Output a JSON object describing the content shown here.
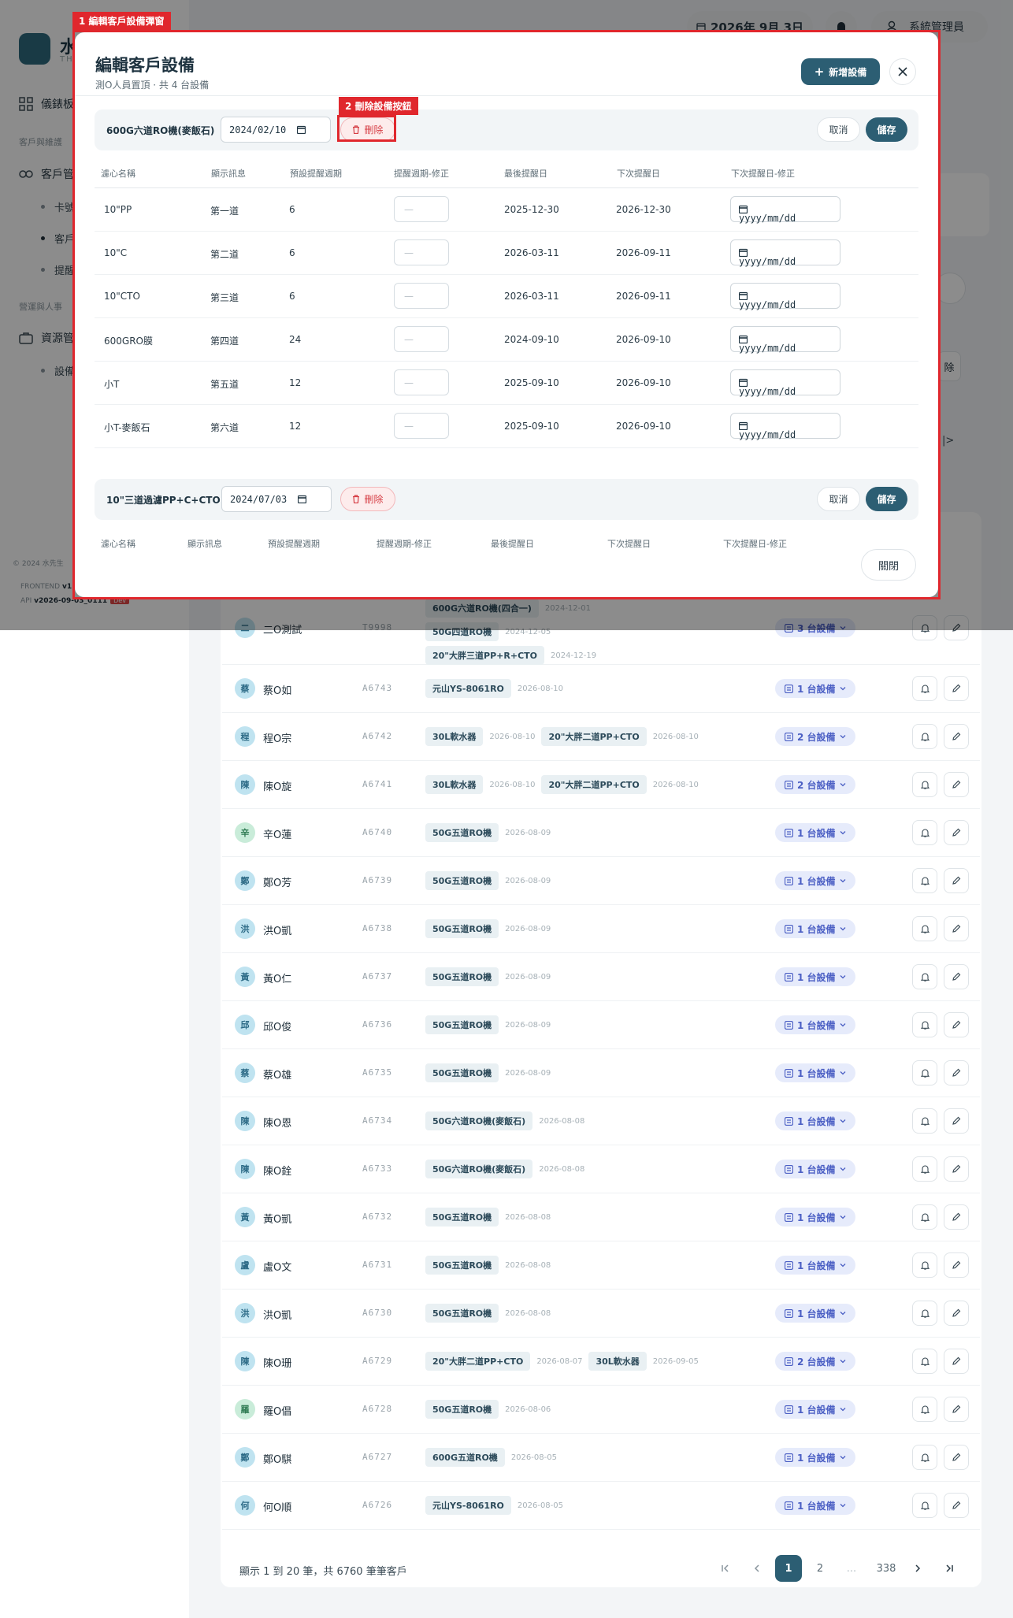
{
  "app": {
    "logo_text": "水",
    "logo_sub": "THE",
    "topbar_date": "2026年 9月 3日",
    "user_name": "系統管理員"
  },
  "sidebar": {
    "dashboard": "儀錶板",
    "section_customers": "客戶與維護",
    "customers": "客戶管",
    "sub1": "卡號",
    "sub2": "客戶",
    "sub3": "提醒",
    "section_admin": "營運與人事",
    "resources": "資源管",
    "sub4": "設備",
    "footer_copy": "© 2024 水先生",
    "footer_frontend_label": "FRONTEND",
    "footer_frontend_val": "v1",
    "footer_api_label": "API",
    "footer_api_val": "v2026-09-03_0111",
    "footer_badge": "Dev"
  },
  "background_partial": {
    "label_1": "除",
    "label_2": "|>"
  },
  "customers": [
    {
      "avatar": "二",
      "color": "#bfe3f0",
      "text_color": "#2c6a86",
      "name": "二O測試",
      "code": "T9998",
      "devices": [
        {
          "name": "600G六道RO機(四合一)",
          "date": "2024-12-01"
        },
        {
          "name": "50G四道RO機",
          "date": "2024-12-05"
        },
        {
          "name": "20\"大胖三道PP+R+CTO",
          "date": "2024-12-19"
        }
      ],
      "count": "3 台設備"
    },
    {
      "avatar": "蔡",
      "color": "#bfe3f0",
      "text_color": "#2c6a86",
      "name": "蔡O如",
      "code": "A6743",
      "devices": [
        {
          "name": "元山YS-8061RO",
          "date": "2026-08-10"
        }
      ],
      "count": "1 台設備"
    },
    {
      "avatar": "程",
      "color": "#bfe3f0",
      "text_color": "#2c6a86",
      "name": "程O宗",
      "code": "A6742",
      "devices": [
        {
          "name": "30L軟水器",
          "date": "2026-08-10"
        },
        {
          "name": "20\"大胖二道PP+CTO",
          "date": "2026-08-10"
        }
      ],
      "count": "2 台設備"
    },
    {
      "avatar": "陳",
      "color": "#bfe3f0",
      "text_color": "#2c6a86",
      "name": "陳O旋",
      "code": "A6741",
      "devices": [
        {
          "name": "30L軟水器",
          "date": "2026-08-10"
        },
        {
          "name": "20\"大胖二道PP+CTO",
          "date": "2026-08-10"
        }
      ],
      "count": "2 台設備"
    },
    {
      "avatar": "辛",
      "color": "#c9ecd9",
      "text_color": "#2e7a52",
      "name": "辛O蓮",
      "code": "A6740",
      "devices": [
        {
          "name": "50G五道RO機",
          "date": "2026-08-09"
        }
      ],
      "count": "1 台設備"
    },
    {
      "avatar": "鄭",
      "color": "#bfe3f0",
      "text_color": "#2c6a86",
      "name": "鄭O芳",
      "code": "A6739",
      "devices": [
        {
          "name": "50G五道RO機",
          "date": "2026-08-09"
        }
      ],
      "count": "1 台設備"
    },
    {
      "avatar": "洪",
      "color": "#bfe3f0",
      "text_color": "#2c6a86",
      "name": "洪O凱",
      "code": "A6738",
      "devices": [
        {
          "name": "50G五道RO機",
          "date": "2026-08-09"
        }
      ],
      "count": "1 台設備"
    },
    {
      "avatar": "黃",
      "color": "#bfe3f0",
      "text_color": "#2c6a86",
      "name": "黃O仁",
      "code": "A6737",
      "devices": [
        {
          "name": "50G五道RO機",
          "date": "2026-08-09"
        }
      ],
      "count": "1 台設備"
    },
    {
      "avatar": "邱",
      "color": "#bfe3f0",
      "text_color": "#2c6a86",
      "name": "邱O俊",
      "code": "A6736",
      "devices": [
        {
          "name": "50G五道RO機",
          "date": "2026-08-09"
        }
      ],
      "count": "1 台設備"
    },
    {
      "avatar": "蔡",
      "color": "#bfe3f0",
      "text_color": "#2c6a86",
      "name": "蔡O雄",
      "code": "A6735",
      "devices": [
        {
          "name": "50G五道RO機",
          "date": "2026-08-09"
        }
      ],
      "count": "1 台設備"
    },
    {
      "avatar": "陳",
      "color": "#bfe3f0",
      "text_color": "#2c6a86",
      "name": "陳O恩",
      "code": "A6734",
      "devices": [
        {
          "name": "50G六道RO機(麥飯石)",
          "date": "2026-08-08"
        }
      ],
      "count": "1 台設備"
    },
    {
      "avatar": "陳",
      "color": "#bfe3f0",
      "text_color": "#2c6a86",
      "name": "陳O銓",
      "code": "A6733",
      "devices": [
        {
          "name": "50G六道RO機(麥飯石)",
          "date": "2026-08-08"
        }
      ],
      "count": "1 台設備"
    },
    {
      "avatar": "黃",
      "color": "#bfe3f0",
      "text_color": "#2c6a86",
      "name": "黃O凱",
      "code": "A6732",
      "devices": [
        {
          "name": "50G五道RO機",
          "date": "2026-08-08"
        }
      ],
      "count": "1 台設備"
    },
    {
      "avatar": "盧",
      "color": "#bfe3f0",
      "text_color": "#2c6a86",
      "name": "盧O文",
      "code": "A6731",
      "devices": [
        {
          "name": "50G五道RO機",
          "date": "2026-08-08"
        }
      ],
      "count": "1 台設備"
    },
    {
      "avatar": "洪",
      "color": "#bfe3f0",
      "text_color": "#2c6a86",
      "name": "洪O凱",
      "code": "A6730",
      "devices": [
        {
          "name": "50G五道RO機",
          "date": "2026-08-08"
        }
      ],
      "count": "1 台設備"
    },
    {
      "avatar": "陳",
      "color": "#bfe3f0",
      "text_color": "#2c6a86",
      "name": "陳O珊",
      "code": "A6729",
      "devices": [
        {
          "name": "20\"大胖二道PP+CTO",
          "date": "2026-08-07"
        },
        {
          "name": "30L軟水器",
          "date": "2026-09-05"
        }
      ],
      "count": "2 台設備"
    },
    {
      "avatar": "羅",
      "color": "#c9ecd9",
      "text_color": "#2e7a52",
      "name": "羅O倡",
      "code": "A6728",
      "devices": [
        {
          "name": "50G五道RO機",
          "date": "2026-08-06"
        }
      ],
      "count": "1 台設備"
    },
    {
      "avatar": "鄭",
      "color": "#bfe3f0",
      "text_color": "#2c6a86",
      "name": "鄭O騏",
      "code": "A6727",
      "devices": [
        {
          "name": "600G五道RO機",
          "date": "2026-08-05"
        }
      ],
      "count": "1 台設備"
    },
    {
      "avatar": "何",
      "color": "#bfe3f0",
      "text_color": "#2c6a86",
      "name": "何O順",
      "code": "A6726",
      "devices": [
        {
          "name": "元山YS-8061RO",
          "date": "2026-08-05"
        }
      ],
      "count": "1 台設備"
    }
  ],
  "pagination": {
    "info": "顯示 1 到 20 筆，共 6760 筆筆客戶",
    "p1": "1",
    "p2": "2",
    "ellipsis": "...",
    "last": "338"
  },
  "modal": {
    "annotation_1": "1 編輯客戶設備彈窗",
    "annotation_2": "2 刪除設備按鈕",
    "title": "編輯客戶設備",
    "subtitle": "測O人員置頂 · 共 4 台設備",
    "add_button": "新增設備",
    "close_button": "關閉",
    "headers": {
      "filter": "濾心名稱",
      "display": "顯示訊息",
      "default_cycle": "預設提醒週期",
      "cycle_fix": "提醒週期-修正",
      "last": "最後提醒日",
      "next": "下次提醒日",
      "next_fix": "下次提醒日-修正"
    },
    "input_blank": "—",
    "date_placeholder": "yyyy/mm/dd",
    "group1": {
      "name": "600G六道RO機(麥飯石)",
      "date": "2024/02/10",
      "delete": "刪除",
      "cancel": "取消",
      "save": "儲存",
      "rows": [
        {
          "filter": "10\"PP",
          "display": "第一道",
          "cycle": "6",
          "last": "2025-12-30",
          "next": "2026-12-30"
        },
        {
          "filter": "10\"C",
          "display": "第二道",
          "cycle": "6",
          "last": "2026-03-11",
          "next": "2026-09-11"
        },
        {
          "filter": "10\"CTO",
          "display": "第三道",
          "cycle": "6",
          "last": "2026-03-11",
          "next": "2026-09-11"
        },
        {
          "filter": "600GRO膜",
          "display": "第四道",
          "cycle": "24",
          "last": "2024-09-10",
          "next": "2026-09-10"
        },
        {
          "filter": "小T",
          "display": "第五道",
          "cycle": "12",
          "last": "2025-09-10",
          "next": "2026-09-10"
        },
        {
          "filter": "小T-麥飯石",
          "display": "第六道",
          "cycle": "12",
          "last": "2025-09-10",
          "next": "2026-09-10"
        }
      ]
    },
    "group2": {
      "name": "10\"三道過濾PP+C+CTO",
      "date": "2024/07/03",
      "delete": "刪除",
      "cancel": "取消",
      "save": "儲存"
    }
  },
  "colors": {
    "primary": "#2c5e73",
    "danger": "#e0272d",
    "badge_bg": "#e6ebfb",
    "badge_text": "#4b5fc4"
  }
}
